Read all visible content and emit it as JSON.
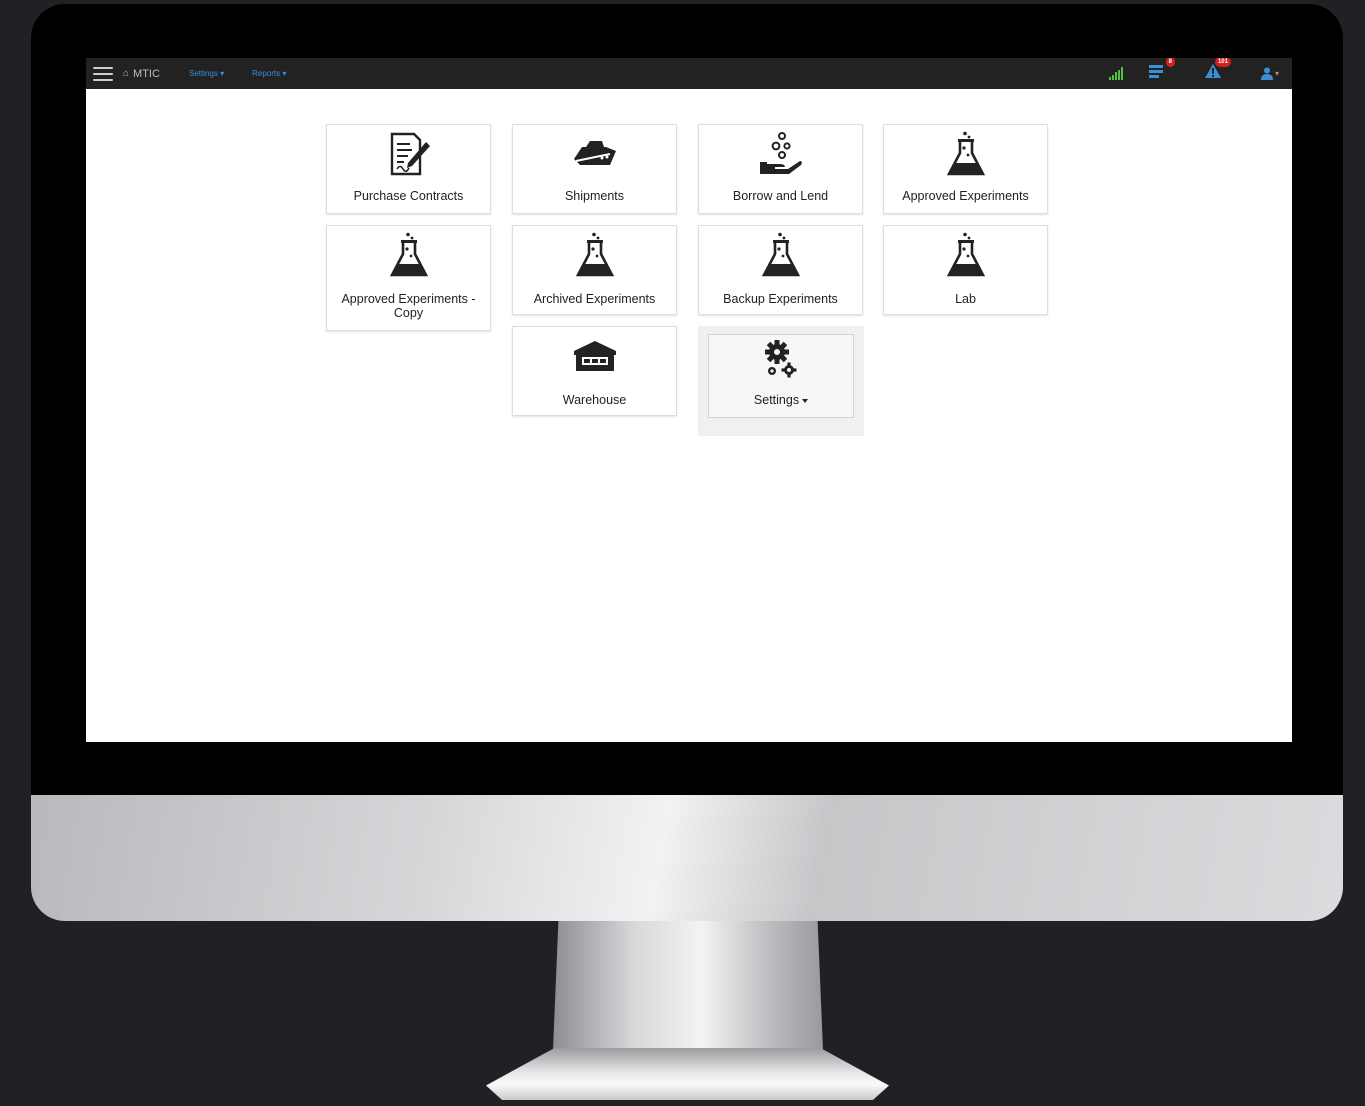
{
  "navbar": {
    "brand": "MTIC",
    "menu_settings": "Settings",
    "menu_reports": "Reports",
    "messages_badge": "8",
    "alerts_badge": "101",
    "accent_color": "#3b8fd6",
    "signal_color": "#4cc43a"
  },
  "tiles": [
    {
      "label": "Purchase Contracts",
      "icon": "contract-icon"
    },
    {
      "label": "Shipments",
      "icon": "ship-icon"
    },
    {
      "label": "Borrow and Lend",
      "icon": "hand-coins-icon"
    },
    {
      "label": "Approved Experiments",
      "icon": "flask-icon"
    },
    {
      "label": "Approved Experiments - Copy",
      "icon": "flask-icon"
    },
    {
      "label": "Archived Experiments",
      "icon": "flask-icon"
    },
    {
      "label": "Backup Experiments",
      "icon": "flask-icon"
    },
    {
      "label": "Lab",
      "icon": "flask-icon"
    },
    {
      "label": "Warehouse",
      "icon": "warehouse-icon"
    },
    {
      "label": "Settings",
      "icon": "gears-icon"
    }
  ]
}
